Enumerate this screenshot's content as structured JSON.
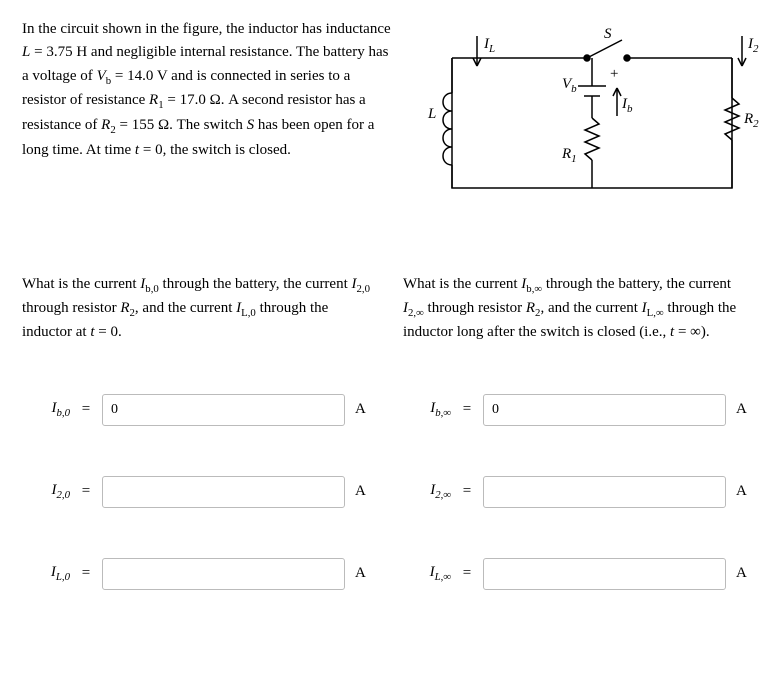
{
  "intro": {
    "p1_a": "In the circuit shown in the figure, the inductor has inductance ",
    "L_sym": "L",
    "eq1": " = ",
    "L_val": "3.75 H",
    "p1_b": " and negligible internal resistance. The battery has a voltage of ",
    "Vb_sym": "V",
    "Vb_sub": "b",
    "Vb_val": "14.0 V",
    "p1_c": " and is connected in series to a resistor of resistance ",
    "R1_sym": "R",
    "R1_sub": "1",
    "R1_val": "17.0 Ω",
    "p1_d": ". A second resistor has a resistance of ",
    "R2_sym": "R",
    "R2_sub": "2",
    "R2_val": "155 Ω",
    "p1_e": ". The switch ",
    "S_sym": "S",
    "p1_f": " has been open for a long time. At time ",
    "t_sym": "t",
    "t_val": "0",
    "p1_g": ", the switch is closed."
  },
  "figure": {
    "IL": "I",
    "IL_sub": "L",
    "I2": "I",
    "I2_sub": "2",
    "Ib": "I",
    "Ib_sub": "b",
    "S": "S",
    "Vb": "V",
    "Vb_sub": "b",
    "plus": "+",
    "L": "L",
    "R1": "R",
    "R1_sub": "1",
    "R2": "R",
    "R2_sub": "2"
  },
  "q_left": {
    "a": "What is the current ",
    "Ib0": "I",
    "Ib0_sub": "b,0",
    "b": " through the battery, the current ",
    "I20": "I",
    "I20_sub": "2,0",
    "c": " through resistor ",
    "R2": "R",
    "R2_sub": "2",
    "d": ", and the current ",
    "IL0": "I",
    "IL0_sub": "L,0",
    "e": " through the inductor at ",
    "t": "t",
    "tv": "0",
    "f": "."
  },
  "q_right": {
    "a": "What is the current ",
    "Ibi": "I",
    "Ibi_sub": "b,∞",
    "b": " through the battery, the current ",
    "I2i": "I",
    "I2i_sub": "2,∞",
    "c": " through resistor ",
    "R2": "R",
    "R2_sub": "2",
    "d": ", and the current ",
    "ILi": "I",
    "ILi_sub": "L,∞",
    "e": " through the inductor long after the switch is closed (i.e., ",
    "t": "t",
    "tv": "∞",
    "f": ")."
  },
  "labels": {
    "eq": "=",
    "unit": "A",
    "Ib0": "I",
    "Ib0_sub": "b,0",
    "I20": "I",
    "I20_sub": "2,0",
    "IL0": "I",
    "IL0_sub": "L,0",
    "Ibi": "I",
    "Ibi_sub": "b,∞",
    "I2i": "I",
    "I2i_sub": "2,∞",
    "ILi": "I",
    "ILi_sub": "L,∞"
  },
  "values": {
    "Ib0": "0",
    "I20": "",
    "IL0": "",
    "Ibi": "0",
    "I2i": "",
    "ILi": ""
  }
}
